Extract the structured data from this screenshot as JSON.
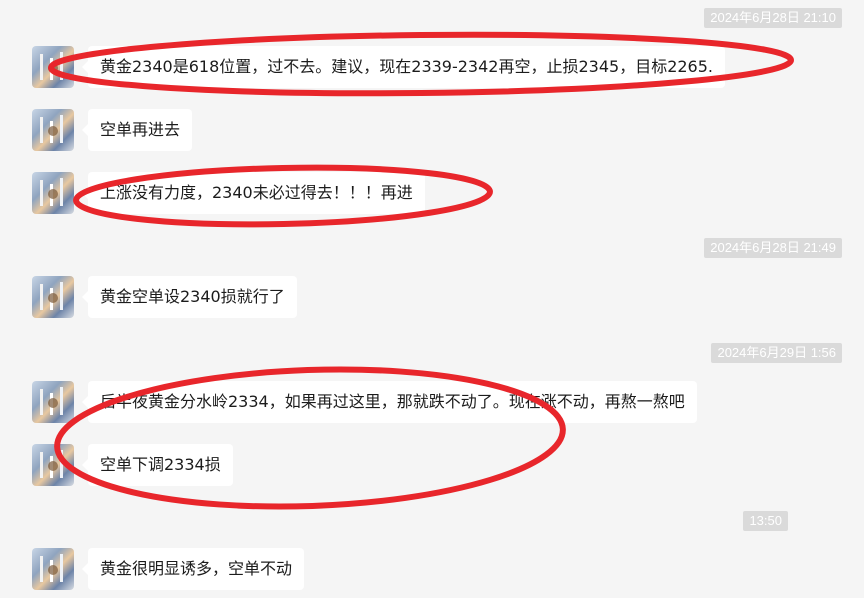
{
  "accent_color": "#e8262b",
  "messages": [
    {
      "text": "黄金2340是618位置，过不去。建议，现在2339-2342再空，止损2345，目标2265."
    },
    {
      "text": "空单再进去"
    },
    {
      "text": "上涨没有力度，2340未必过得去！！！再进"
    },
    {
      "text": "黄金空单设2340损就行了"
    },
    {
      "text": "后半夜黄金分水岭2334，如果再过这里，那就跌不动了。现在涨不动，再熬一熬吧"
    },
    {
      "text": "空单下调2334损"
    },
    {
      "text": "黄金很明显诱多，空单不动"
    }
  ],
  "timestamps": [
    {
      "text": "2024年6月28日 21:10"
    },
    {
      "text": "2024年6月28日 21:49"
    },
    {
      "text": "2024年6月29日 1:56"
    },
    {
      "text": "13:50"
    }
  ]
}
